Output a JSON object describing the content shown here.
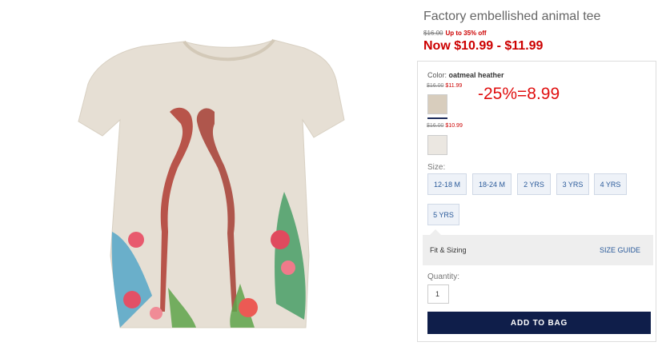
{
  "product": {
    "title": "Factory embellished animal tee",
    "promo_original": "$16.00",
    "promo_off": "Up to 35% off",
    "now_price": "Now $10.99 - $11.99"
  },
  "color": {
    "label": "Color:",
    "selected": "oatmeal heather",
    "swatches": [
      {
        "original": "$16.00",
        "price": "$11.99",
        "hex": "#d8cdbd"
      },
      {
        "original": "$16.00",
        "price": "$10.99",
        "hex": "#ebe7e1"
      }
    ]
  },
  "annotation": "-25%=8.99",
  "size": {
    "label": "Size:",
    "options": [
      "12-18 M",
      "18-24 M",
      "2 YRS",
      "3 YRS",
      "4 YRS",
      "5 YRS"
    ]
  },
  "fit": {
    "label": "Fit & Sizing",
    "size_guide": "SIZE GUIDE"
  },
  "quantity": {
    "label": "Quantity:",
    "value": "1"
  },
  "add_to_bag": "ADD TO BAG"
}
